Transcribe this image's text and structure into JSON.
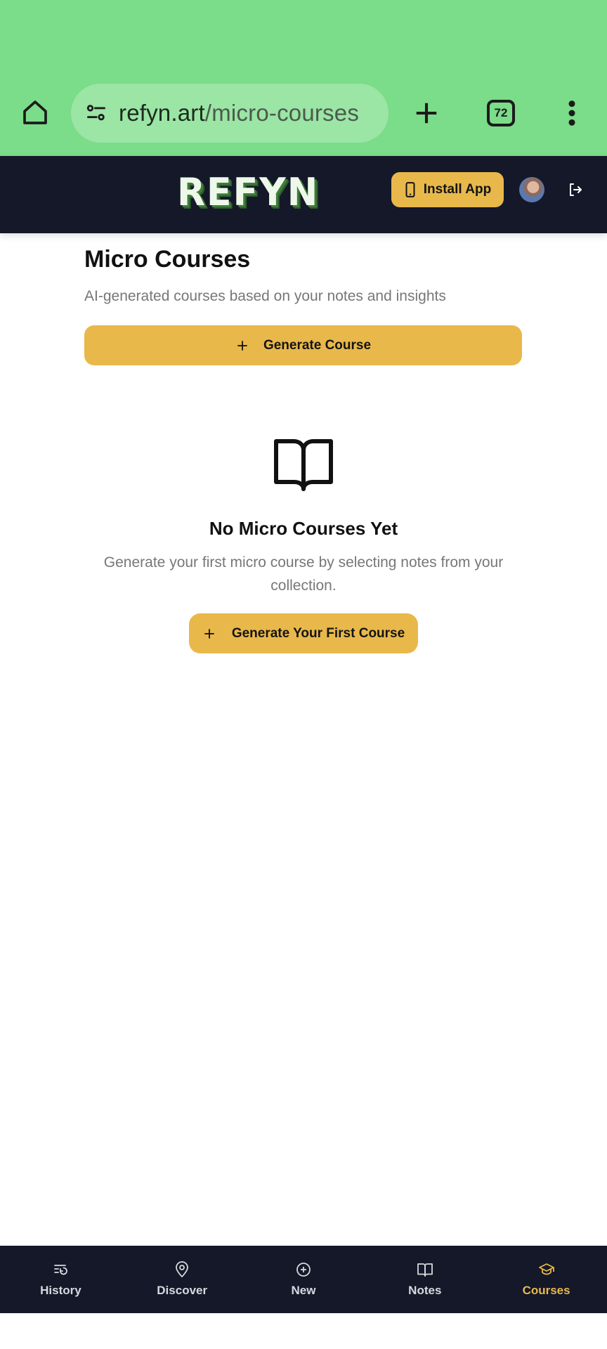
{
  "browser": {
    "url_domain": "refyn.art",
    "url_path": "/micro-courses",
    "tab_count": "72",
    "theme_color": "#7bdc89"
  },
  "header": {
    "logo_text": "REFYN",
    "install_label": "Install App",
    "accent_color": "#e9b84b",
    "background_color": "#141829"
  },
  "main": {
    "title": "Micro Courses",
    "subtitle": "AI-generated courses based on your notes and insights",
    "generate_label": "Generate Course",
    "empty_icon": "book-open-icon",
    "empty_title": "No Micro Courses Yet",
    "empty_description": "Generate your first micro course by selecting notes from your collection.",
    "first_course_label": "Generate Your First Course"
  },
  "nav": {
    "items": [
      {
        "label": "History",
        "icon": "history-icon",
        "active": false
      },
      {
        "label": "Discover",
        "icon": "map-pin-icon",
        "active": false
      },
      {
        "label": "New",
        "icon": "plus-circle-icon",
        "active": false
      },
      {
        "label": "Notes",
        "icon": "book-icon",
        "active": false
      },
      {
        "label": "Courses",
        "icon": "graduation-cap-icon",
        "active": true
      }
    ]
  }
}
